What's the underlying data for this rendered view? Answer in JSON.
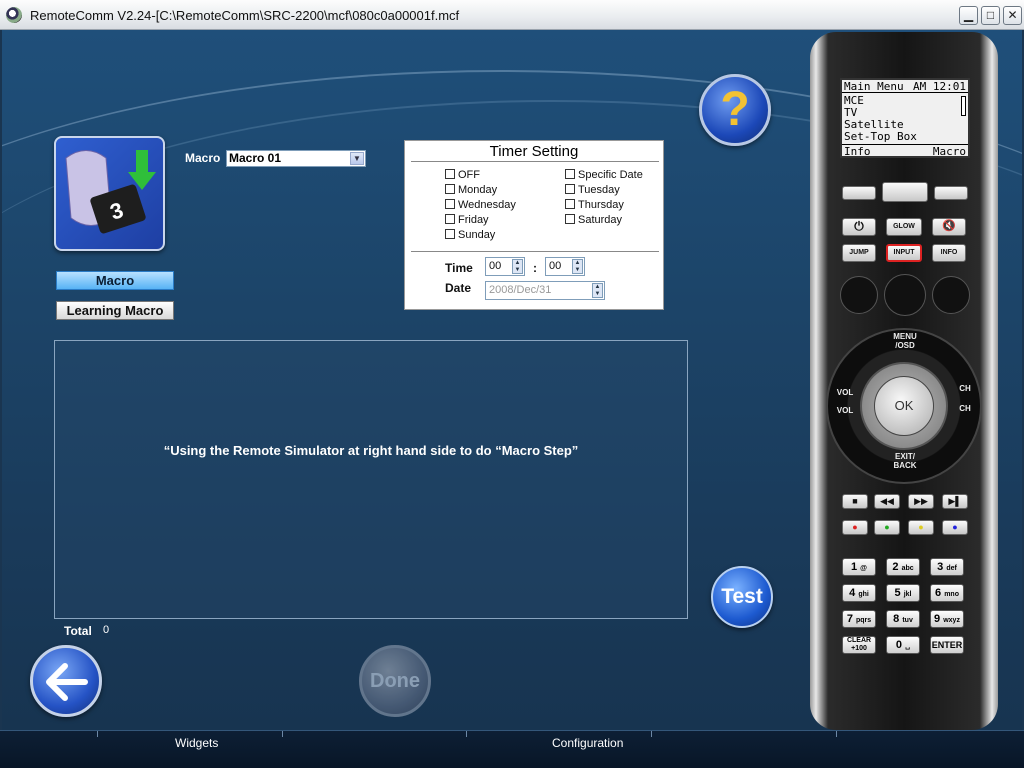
{
  "window": {
    "title": "RemoteComm V2.24-[C:\\RemoteComm\\SRC-2200\\mcf\\080c0a00001f.mcf",
    "min_glyph": "▁",
    "max_glyph": "□",
    "close_glyph": "✕"
  },
  "sidebar": {
    "macro_tab": "Macro",
    "learning_macro_tab": "Learning Macro"
  },
  "macro_select": {
    "label": "Macro",
    "value": "Macro 01"
  },
  "timer": {
    "title": "Timer Setting",
    "days_left": [
      "OFF",
      "Monday",
      "Wednesday",
      "Friday",
      "Sunday"
    ],
    "days_right": [
      "Specific Date",
      "Tuesday",
      "Thursday",
      "Saturday"
    ],
    "time_label": "Time",
    "hour": "00",
    "colon": ":",
    "minute": "00",
    "date_label": "Date",
    "date_value": "2008/Dec/31"
  },
  "help": {
    "glyph": "?"
  },
  "steps": {
    "message": "“Using the Remote Simulator at right hand side to do “Macro Step”"
  },
  "total": {
    "label": "Total",
    "value": "0"
  },
  "buttons": {
    "done": "Done",
    "test": "Test"
  },
  "remote": {
    "screen": {
      "header_left": "Main Menu",
      "header_right": "AM 12:01",
      "items": [
        "MCE",
        "TV",
        "Satellite",
        "Set-Top Box"
      ],
      "footer_left": "Info",
      "footer_right": "Macro"
    },
    "keys": {
      "glow": "GLOW",
      "jump": "JUMP",
      "input": "INPUT",
      "info": "INFO",
      "menu": "MENU /OSD",
      "exit": "EXIT/ BACK",
      "vol": "VOL",
      "ch": "CH",
      "ok": "OK",
      "clear": "CLEAR +100",
      "enter": "ENTER"
    },
    "numpad": [
      {
        "d": "1",
        "s": "@"
      },
      {
        "d": "2",
        "s": "abc"
      },
      {
        "d": "3",
        "s": "def"
      },
      {
        "d": "4",
        "s": "ghi"
      },
      {
        "d": "5",
        "s": "jkl"
      },
      {
        "d": "6",
        "s": "mno"
      },
      {
        "d": "7",
        "s": "pqrs"
      },
      {
        "d": "8",
        "s": "tuv"
      },
      {
        "d": "9",
        "s": "wxyz"
      }
    ],
    "zero": "0"
  },
  "taskbar": {
    "tabs": [
      "Widgets",
      "Configuration"
    ]
  },
  "colors": {
    "background": "#1c4468",
    "accent": "#57b3f5",
    "help_question": "#f2c233"
  }
}
